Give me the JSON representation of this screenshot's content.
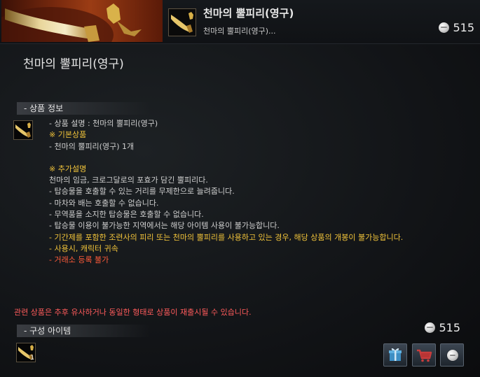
{
  "header": {
    "title": "천마의 뿔피리(영구)",
    "subtitle": "천마의 뿔피리(영구)...",
    "price": "515"
  },
  "main": {
    "title": "천마의 뿔피리(영구)"
  },
  "product_info": {
    "section_label": "- 상품 정보",
    "lines": [
      {
        "text": "- 상품 설명 : 천마의 뿔피리(영구)",
        "style": "normal"
      },
      {
        "text": "※ 기본상품",
        "style": "gold"
      },
      {
        "text": "- 천마의 뿔피리(영구) 1개",
        "style": "normal"
      },
      {
        "text": "",
        "style": "gap"
      },
      {
        "text": "※ 추가설명",
        "style": "gold"
      },
      {
        "text": "천마의 임금, 크로그달로의 포효가 담긴 뿔피리다.",
        "style": "normal"
      },
      {
        "text": "- 탑승물을 호출할 수 있는 거리를 무제한으로 늘려줍니다.",
        "style": "normal"
      },
      {
        "text": "- 마차와 배는 호출할 수 없습니다.",
        "style": "normal"
      },
      {
        "text": "- 무역품을 소지한 탑승물은 호출할 수 없습니다.",
        "style": "normal"
      },
      {
        "text": "- 탑승물 이용이 불가능한 지역에서는 해당 아이템 사용이 불가능합니다.",
        "style": "normal"
      },
      {
        "text": "- 기간제를 포함한 조련사의 피리 또는 천마의 뿔피리를 사용하고 있는 경우, 해당 상품의 개봉이 불가능합니다.",
        "style": "gold"
      },
      {
        "text": "- 사용시, 캐릭터 귀속",
        "style": "gold"
      },
      {
        "text": "- 거래소 등록 불가",
        "style": "red"
      }
    ]
  },
  "notice": "관련 상품은 추후 유사하거나 동일한 형태로 상품이 재출시될 수 있습니다.",
  "components": {
    "section_label": "- 구성 아이템",
    "item_count": "1"
  },
  "bottom": {
    "price": "515"
  },
  "icons": {
    "header_coin": "silver-coin-icon",
    "gift": "gift-icon",
    "cart": "cart-icon",
    "buy": "silver-coin-icon",
    "item": "horn-icon"
  },
  "colors": {
    "gold_text": "#f2c43a",
    "red_text": "#ff5b3a",
    "notice_text": "#ff5b5b"
  }
}
